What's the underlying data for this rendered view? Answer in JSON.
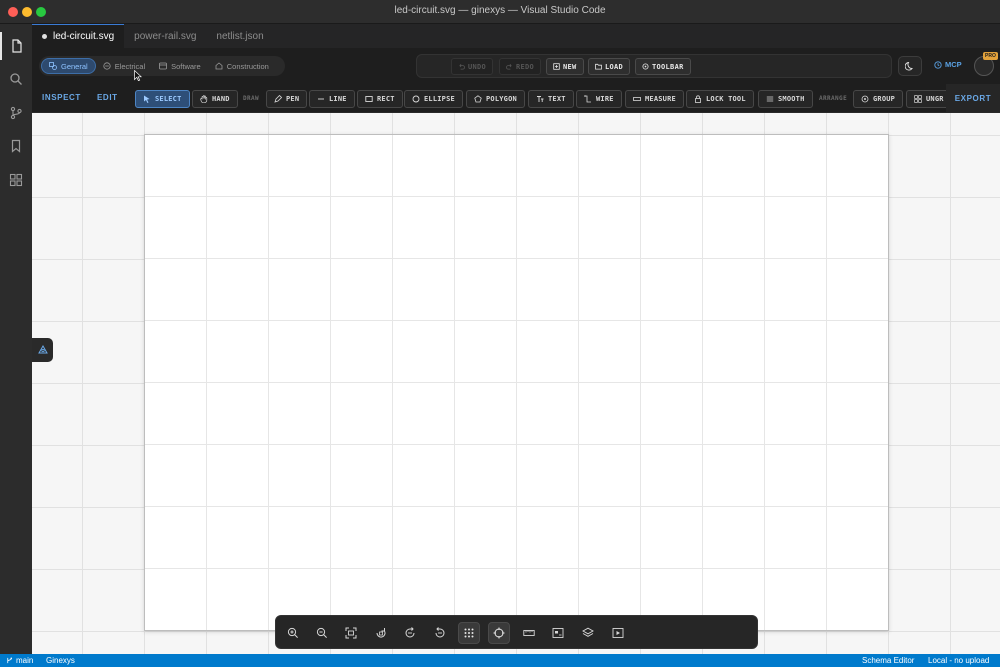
{
  "window": {
    "title": "led-circuit.svg — ginexys — Visual Studio Code"
  },
  "tabs": [
    {
      "label": "led-circuit.svg"
    },
    {
      "label": "power-rail.svg"
    },
    {
      "label": "netlist.json"
    }
  ],
  "categories": {
    "items": [
      {
        "label": "General"
      },
      {
        "label": "Electrical"
      },
      {
        "label": "Software"
      },
      {
        "label": "Construction"
      }
    ]
  },
  "actions": {
    "undo": "UNDO",
    "redo": "REDO",
    "new": "NEW",
    "load": "LOAD",
    "toolbar": "TOOLBAR"
  },
  "header": {
    "mcp_label": "MCP",
    "pro_badge": "PRO"
  },
  "modes": {
    "inspect": "INSPECT",
    "edit": "EDIT",
    "export": "EXPORT"
  },
  "tools": {
    "select": "SELECT",
    "hand": "HAND",
    "draw_section": "DRAW",
    "pen": "PEN",
    "line": "LINE",
    "rect": "RECT",
    "ellipse": "ELLIPSE",
    "polygon": "POLYGON",
    "text": "TEXT",
    "wire": "WIRE",
    "measure": "MEASURE",
    "lock_tool": "LOCK TOOL",
    "smooth": "SMOOTH",
    "arrange_section": "ARRANGE",
    "group": "GROUP",
    "ungroup": "UNGR"
  },
  "bottom_toolbar": {
    "icons": [
      "zoom-in-icon",
      "zoom-out-icon",
      "fit-view-icon",
      "rotate-left-icon",
      "redo-icon",
      "undo-icon",
      "grid-icon",
      "snap-icon",
      "ruler-icon",
      "minimap-icon",
      "layers-icon",
      "preview-icon"
    ],
    "active": [
      "grid-icon",
      "snap-icon"
    ]
  },
  "statusbar": {
    "branch": "main",
    "project": "Ginexys",
    "editor": "Schema Editor",
    "storage": "Local - no upload"
  },
  "colors": {
    "accent": "#5aa1e3",
    "statusbar": "#007acc",
    "pro_badge": "#e3a23b"
  }
}
